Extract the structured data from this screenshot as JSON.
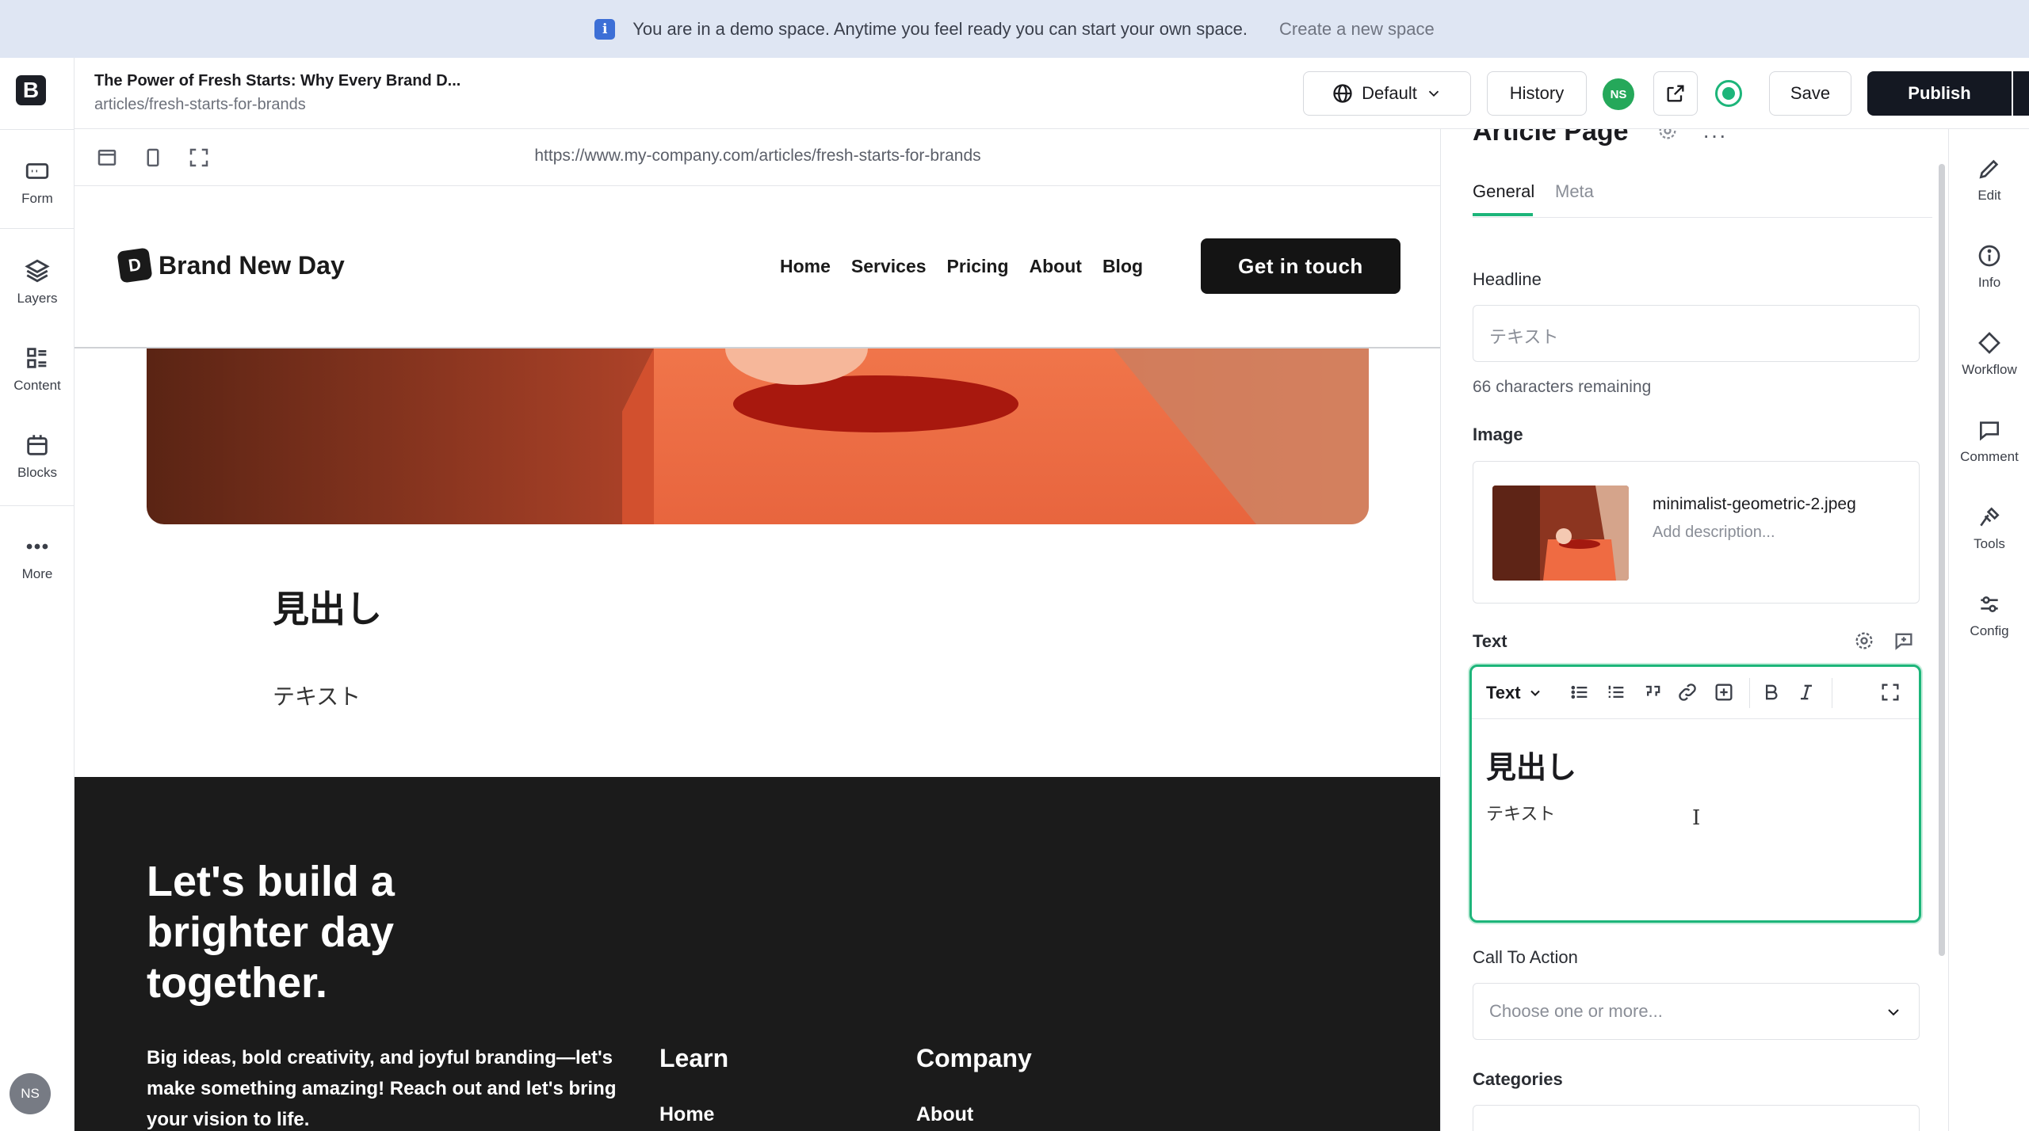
{
  "banner": {
    "message": "You are in a demo space. Anytime you feel ready you can start your own space.",
    "link": "Create a new space"
  },
  "left_rail": {
    "items": [
      {
        "label": "Form",
        "icon": "form-icon"
      },
      {
        "label": "Layers",
        "icon": "layers-icon"
      },
      {
        "label": "Content",
        "icon": "content-icon"
      },
      {
        "label": "Blocks",
        "icon": "blocks-icon"
      },
      {
        "label": "More",
        "icon": "more-icon"
      }
    ],
    "avatar": "NS"
  },
  "topbar": {
    "title": "The Power of Fresh Starts: Why Every Brand D...",
    "path": "articles/fresh-starts-for-brands",
    "language": "Default",
    "history": "History",
    "avatar": "NS",
    "save": "Save",
    "publish": "Publish"
  },
  "preview": {
    "url": "https://www.my-company.com/articles/fresh-starts-for-brands",
    "site": {
      "logo_mark": "D",
      "logo_text": "Brand New Day",
      "nav": [
        "Home",
        "Services",
        "Pricing",
        "About",
        "Blog"
      ],
      "cta": "Get in touch"
    },
    "heading": "見出し",
    "text": "テキスト",
    "footer": {
      "headline": "Let's build a brighter day together.",
      "body": "Big ideas, bold creativity, and joyful branding—let's make something amazing! Reach out and let's bring your vision to life.",
      "col1_title": "Learn",
      "col1_item": "Home",
      "col2_title": "Company",
      "col2_item": "About"
    }
  },
  "panel": {
    "title": "Article Page",
    "tabs": [
      "General",
      "Meta"
    ],
    "headline_label": "Headline",
    "headline_value": "テキスト",
    "headline_hint": "66 characters remaining",
    "image_label": "Image",
    "image_name": "minimalist-geometric-2.jpeg",
    "image_desc_placeholder": "Add description...",
    "text_label": "Text",
    "editor_style": "Text",
    "editor_heading": "見出し",
    "editor_text": "テキスト",
    "cta_label": "Call To Action",
    "cta_placeholder": "Choose one or more...",
    "categories_label": "Categories"
  },
  "right_rail": {
    "items": [
      {
        "label": "Edit",
        "icon": "pencil-icon"
      },
      {
        "label": "Info",
        "icon": "info-icon"
      },
      {
        "label": "Workflow",
        "icon": "workflow-icon"
      },
      {
        "label": "Comment",
        "icon": "comment-icon"
      },
      {
        "label": "Tools",
        "icon": "tools-icon"
      },
      {
        "label": "Config",
        "icon": "config-icon"
      }
    ]
  },
  "colors": {
    "accent": "#1db57a",
    "publish": "#141822",
    "footer_bg": "#1b1b1b",
    "banner_bg": "#dfe6f3"
  }
}
